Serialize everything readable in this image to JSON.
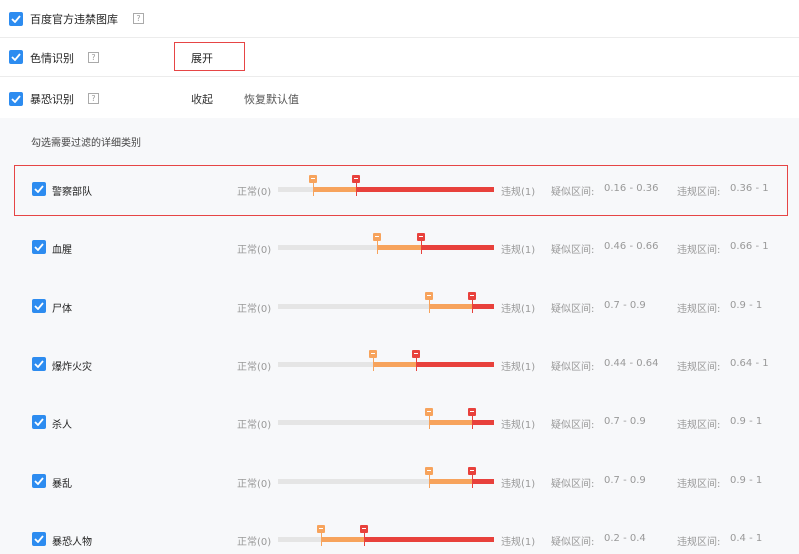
{
  "top_rows": [
    {
      "label": "百度官方违禁图库",
      "help": "?"
    },
    {
      "label": "色情识别",
      "help": "?"
    },
    {
      "label": "暴恐识别",
      "help": "?"
    }
  ],
  "expand_label": "展开",
  "collapse_label": "收起",
  "restore_label": "恢复默认值",
  "panel_title": "勾选需要过滤的详细类别",
  "normal_label": "正常(0)",
  "violation_label": "违规(1)",
  "suspect_range_label": "疑似区间:",
  "violation_range_label": "违规区间:",
  "colors": {
    "checkbox": "#2d8cf0",
    "orange": "#f7a35c",
    "red": "#e8413c",
    "highlight": "#e64545"
  },
  "categories": [
    {
      "name": "警察部队",
      "low": 0.16,
      "high": 0.36,
      "suspect_text": "0.16  -  0.36",
      "violation_text": "0.36  -  1"
    },
    {
      "name": "血腥",
      "low": 0.46,
      "high": 0.66,
      "suspect_text": "0.46  -  0.66",
      "violation_text": "0.66  -  1"
    },
    {
      "name": "尸体",
      "low": 0.7,
      "high": 0.9,
      "suspect_text": "0.7  -  0.9",
      "violation_text": "0.9  -  1"
    },
    {
      "name": "爆炸火灾",
      "low": 0.44,
      "high": 0.64,
      "suspect_text": "0.44  -  0.64",
      "violation_text": "0.64  -  1"
    },
    {
      "name": "杀人",
      "low": 0.7,
      "high": 0.9,
      "suspect_text": "0.7  -  0.9",
      "violation_text": "0.9  -  1"
    },
    {
      "name": "暴乱",
      "low": 0.7,
      "high": 0.9,
      "suspect_text": "0.7  -  0.9",
      "violation_text": "0.9  -  1"
    },
    {
      "name": "暴恐人物",
      "low": 0.2,
      "high": 0.4,
      "suspect_text": "0.2  -  0.4",
      "violation_text": "0.4  -  1"
    }
  ]
}
